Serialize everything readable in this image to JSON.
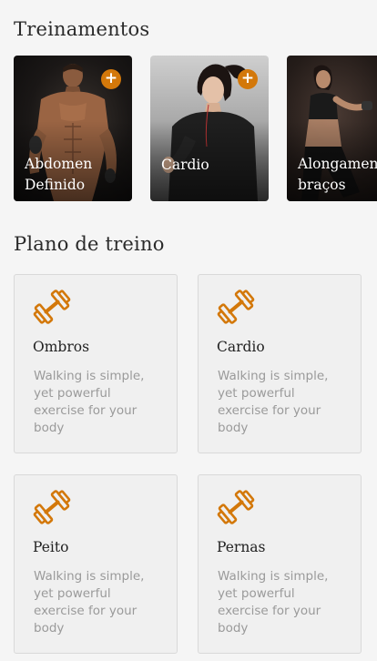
{
  "trainings": {
    "title": "Treinamentos",
    "items": [
      {
        "label": "Abdomen Definido",
        "add_label": "+"
      },
      {
        "label": "Cardio",
        "add_label": "+"
      },
      {
        "label": "Alongamento braços",
        "line1": "Alongamen",
        "line2": "braços",
        "add_label": "+"
      }
    ]
  },
  "plan": {
    "title": "Plano de treino",
    "cards": [
      {
        "title": "Ombros",
        "desc": "Walking is simple, yet powerful exercise for your body",
        "icon": "dumbbell-icon"
      },
      {
        "title": "Cardio",
        "desc": "Walking is simple, yet powerful exercise for your body",
        "icon": "dumbbell-icon"
      },
      {
        "title": "Peito",
        "desc": "Walking is simple, yet powerful exercise for your body",
        "icon": "dumbbell-icon"
      },
      {
        "title": "Pernas",
        "desc": "Walking is simple, yet powerful exercise for your body",
        "icon": "dumbbell-icon"
      }
    ]
  },
  "colors": {
    "accent": "#d3780a",
    "background": "#f5f5f5",
    "card_background": "#f0f0f0"
  }
}
